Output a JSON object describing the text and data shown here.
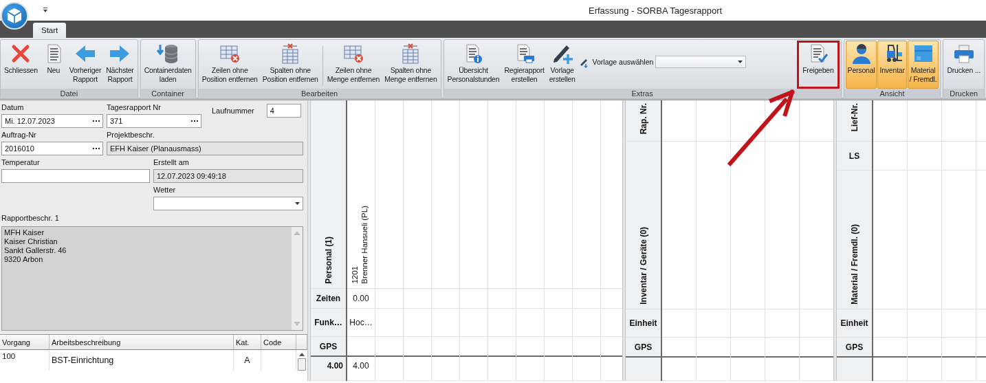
{
  "window": {
    "title": "Erfassung - SORBA Tagesrapport"
  },
  "tabs": [
    {
      "label": "Start",
      "selected": true
    }
  ],
  "ribbon": [
    {
      "label": "Datei",
      "items": [
        {
          "kind": "large",
          "label": "Schliessen"
        },
        {
          "kind": "large",
          "label": "Neu"
        },
        {
          "kind": "large",
          "label": "Vorheriger\nRapport"
        },
        {
          "kind": "large",
          "label": "Nächster\nRapport"
        }
      ]
    },
    {
      "label": "Container",
      "items": [
        {
          "kind": "large",
          "label": "Containerdaten\nladen"
        }
      ]
    },
    {
      "label": "Bearbeiten",
      "items": [
        {
          "kind": "large",
          "label": "Zeilen ohne\nPosition entfernen"
        },
        {
          "kind": "large",
          "label": "Spalten ohne\nPosition entfernen"
        },
        {
          "kind": "separator"
        },
        {
          "kind": "large",
          "label": "Zeilen ohne\nMenge entfernen"
        },
        {
          "kind": "large",
          "label": "Spalten ohne\nMenge entfernen"
        }
      ]
    },
    {
      "label": "Extras",
      "items": [
        {
          "kind": "large",
          "label": "Übersicht\nPersonalstunden"
        },
        {
          "kind": "large",
          "label": "Regierapport\nerstellen"
        },
        {
          "kind": "large",
          "label": "Vorlage\nerstellen"
        },
        {
          "kind": "combo",
          "label": "Vorlage auswählen"
        },
        {
          "kind": "large",
          "label": "Freigeben",
          "highlighted": true
        }
      ]
    },
    {
      "label": "Ansicht",
      "items": [
        {
          "kind": "large",
          "label": "Personal",
          "selected": true
        },
        {
          "kind": "large",
          "label": "Inventar",
          "selected": true
        },
        {
          "kind": "large",
          "label": "Material\n/ Fremdl.",
          "selected": true
        }
      ]
    },
    {
      "label": "Drucken",
      "items": [
        {
          "kind": "large",
          "label": "Drucken ..."
        }
      ]
    }
  ],
  "form": {
    "datum": {
      "label": "Datum",
      "value": "Mi. 12.07.2023",
      "kind": "lookup"
    },
    "tagesrapport_nr": {
      "label": "Tagesrapport Nr",
      "value": "371",
      "kind": "lookup"
    },
    "laufnummer": {
      "label": "Laufnummer",
      "value": "4"
    },
    "auftrag_nr": {
      "label": "Auftrag-Nr",
      "value": "2016010",
      "kind": "lookup"
    },
    "projektbeschr": {
      "label": "Projektbeschr.",
      "value": "EFH Kaiser (Planausmass)",
      "kind": "readonly"
    },
    "temperatur": {
      "label": "Temperatur"
    },
    "erstellt_am": {
      "label": "Erstellt am",
      "value": "12.07.2023 09:49:18",
      "kind": "readonly"
    },
    "wetter": {
      "label": "Wetter",
      "kind": "dropdown"
    },
    "rapportbeschr": {
      "label": "Rapportbeschr. 1",
      "lines": [
        "MFH Kaiser",
        "Kaiser Christian",
        "Sankt Gallerstr. 46",
        "9320 Arbon"
      ]
    }
  },
  "work_table": {
    "columns": [
      "Vorgang",
      "Arbeitsbeschreibung",
      "Kat.",
      "Code"
    ],
    "rows": [
      {
        "vorgang": "100",
        "beschreibung": "BST-Einrichtung",
        "kat": "A"
      }
    ]
  },
  "personal": {
    "title": "Personal (1)",
    "row_labels": [
      "Zeiten",
      "Funk…",
      "GPS"
    ],
    "total": "4.00",
    "employees": [
      {
        "number": "1201",
        "name": "Brenner Hansueli (PL)",
        "zeiten": "0.00",
        "funktion": "Hoc…",
        "total": "4.00"
      }
    ]
  },
  "inventar": {
    "header": "Rap. Nr.",
    "title": "Inventar / Geräte (0)",
    "row_labels": [
      "Einheit",
      "GPS"
    ]
  },
  "material": {
    "headers": [
      "Lief-Nr.",
      "LS"
    ],
    "title": "Material / Fremdl. (0)",
    "row_labels": [
      "Einheit",
      "GPS"
    ]
  }
}
